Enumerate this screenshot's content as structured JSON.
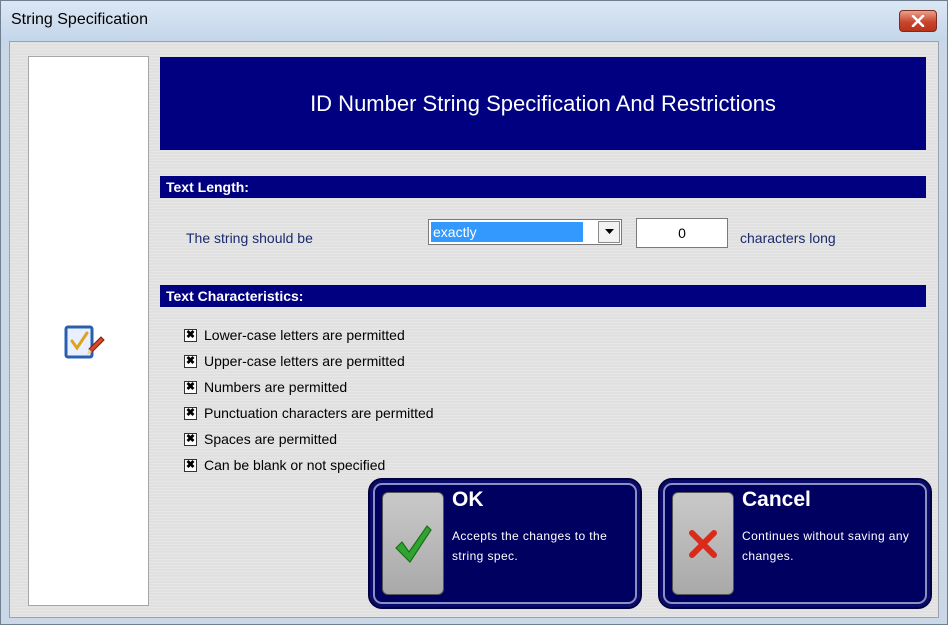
{
  "window": {
    "title": "String Specification"
  },
  "header": {
    "title": "ID Number String Specification And Restrictions"
  },
  "text_length": {
    "section_label": "Text Length:",
    "prefix_label": "The string should be",
    "mode_value": "exactly",
    "count_value": "0",
    "suffix_label": "characters long"
  },
  "text_characteristics": {
    "section_label": "Text Characteristics:",
    "options": [
      {
        "label": "Lower-case letters are permitted",
        "checked": true
      },
      {
        "label": "Upper-case letters are permitted",
        "checked": true
      },
      {
        "label": "Numbers are permitted",
        "checked": true
      },
      {
        "label": "Punctuation characters are permitted",
        "checked": true
      },
      {
        "label": "Spaces are permitted",
        "checked": true
      },
      {
        "label": "Can be blank or not specified",
        "checked": true
      }
    ]
  },
  "buttons": {
    "ok": {
      "title": "OK",
      "description": "Accepts the changes to the string spec.",
      "icon": "checkmark-icon"
    },
    "cancel": {
      "title": "Cancel",
      "description": "Continues without saving any changes.",
      "icon": "red-x-icon"
    }
  },
  "colors": {
    "header_bg": "#000080",
    "button_bg": "#000060",
    "selection": "#3399ff"
  }
}
